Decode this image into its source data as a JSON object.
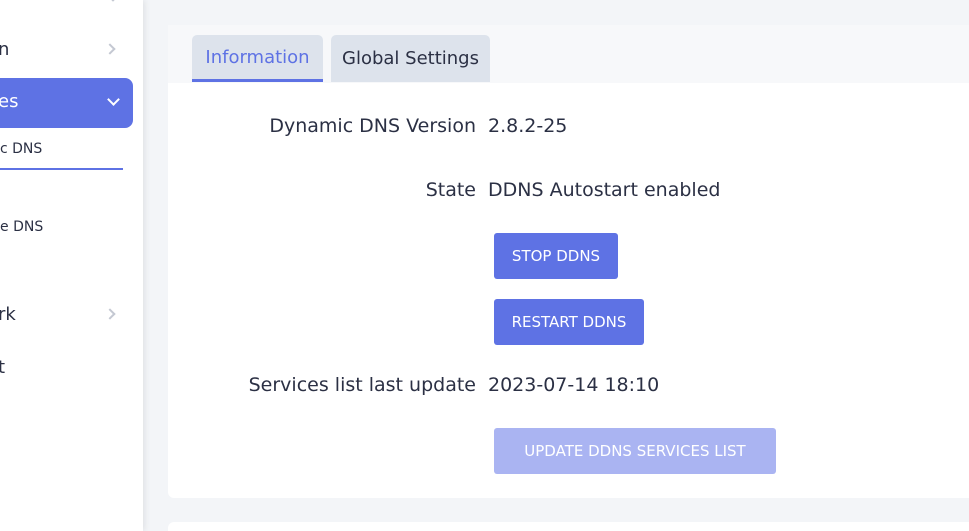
{
  "sidebar": {
    "items": [
      {
        "label": "n"
      },
      {
        "label": "es",
        "active": true
      },
      {
        "label": "c DNS",
        "sub": true,
        "selected": true
      },
      {
        "label": "e DNS",
        "sub": true
      },
      {
        "label": "rk"
      },
      {
        "label": "t"
      }
    ]
  },
  "tabs": [
    {
      "label": "Information",
      "active": true
    },
    {
      "label": "Global Settings",
      "active": false
    }
  ],
  "info": {
    "version_label": "Dynamic DNS Version",
    "version_value": "2.8.2-25",
    "state_label": "State",
    "state_value": "DDNS Autostart enabled",
    "stop_button": "STOP DDNS",
    "restart_button": "RESTART DDNS",
    "services_label": "Services list last update",
    "services_value": "2023-07-14 18:10",
    "update_button": "UPDATE DDNS SERVICES LIST"
  },
  "colors": {
    "accent": "#5e72e4",
    "accent_disabled": "#aab4f2",
    "tab_bg": "#dde3ec",
    "page_bg": "#f3f5f8"
  }
}
